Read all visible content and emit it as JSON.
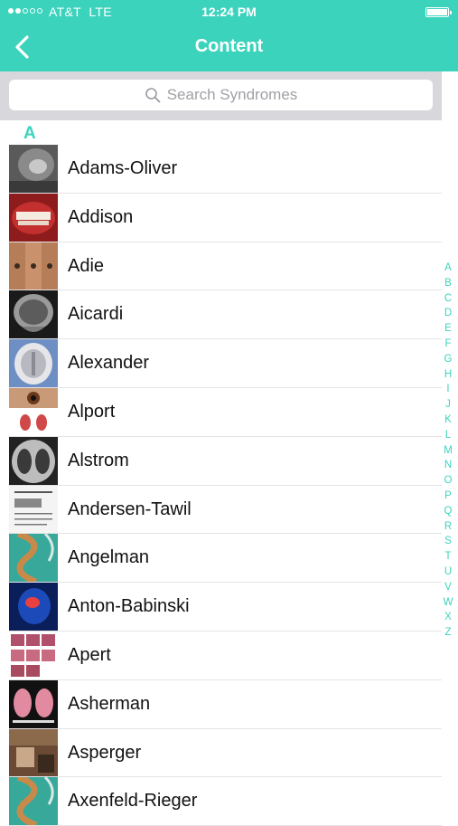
{
  "status_bar": {
    "carrier": "AT&T",
    "network": "LTE",
    "time": "12:24 PM",
    "signal_bars_filled": 2,
    "signal_bars_total": 5
  },
  "nav": {
    "title": "Content",
    "back_icon": "chevron-left-icon"
  },
  "search": {
    "placeholder": "Search Syndromes",
    "icon": "search-icon"
  },
  "section": {
    "letter": "A"
  },
  "items": [
    {
      "label": "Adams-Oliver",
      "thumb": "scan-grey"
    },
    {
      "label": "Addison",
      "thumb": "mouth-red"
    },
    {
      "label": "Adie",
      "thumb": "faces-tan"
    },
    {
      "label": "Aicardi",
      "thumb": "mri-sagittal"
    },
    {
      "label": "Alexander",
      "thumb": "mri-axial"
    },
    {
      "label": "Alport",
      "thumb": "eye-kidney"
    },
    {
      "label": "Alstrom",
      "thumb": "xray-chest"
    },
    {
      "label": "Andersen-Tawil",
      "thumb": "document"
    },
    {
      "label": "Angelman",
      "thumb": "dna-teal"
    },
    {
      "label": "Anton-Babinski",
      "thumb": "head-blue"
    },
    {
      "label": "Apert",
      "thumb": "hands-grid"
    },
    {
      "label": "Asherman",
      "thumb": "ultrasound-pink"
    },
    {
      "label": "Asperger",
      "thumb": "photo-brown"
    },
    {
      "label": "Axenfeld-Rieger",
      "thumb": "dna-teal"
    }
  ],
  "index": [
    "A",
    "B",
    "C",
    "D",
    "E",
    "F",
    "G",
    "H",
    "I",
    "J",
    "K",
    "L",
    "M",
    "N",
    "O",
    "P",
    "Q",
    "R",
    "S",
    "T",
    "U",
    "V",
    "W",
    "X",
    "Z"
  ],
  "colors": {
    "accent": "#3cd3bd",
    "search_bg": "#d8d8dc",
    "separator": "#e3e3e6"
  }
}
